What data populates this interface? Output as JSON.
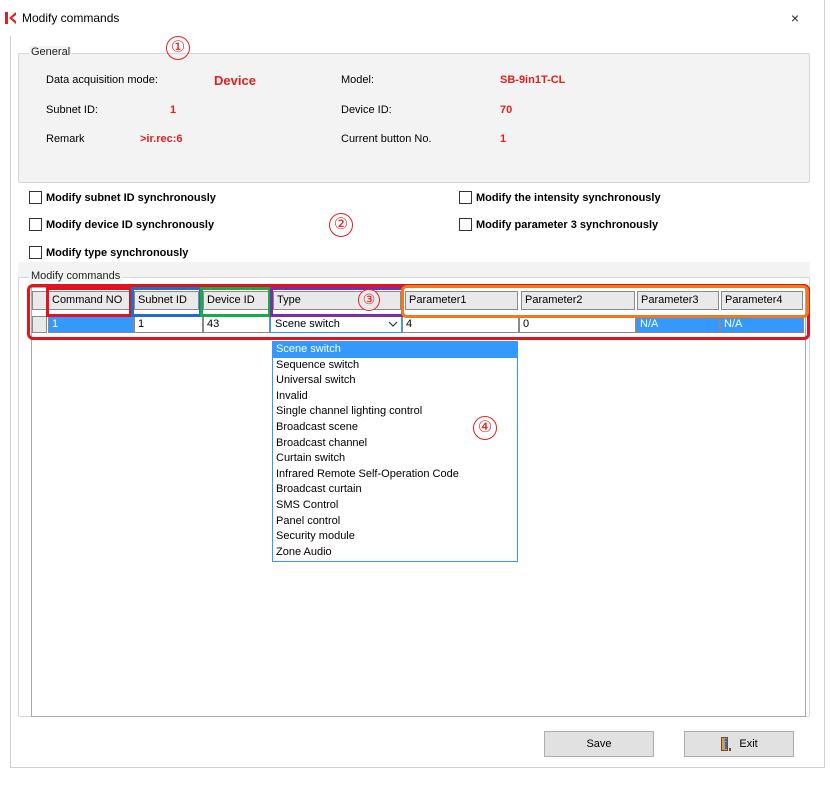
{
  "window": {
    "title": "Modify commands",
    "close": "×"
  },
  "general": {
    "legend": "General",
    "marker": "①",
    "fields": [
      {
        "label": "Data acquisition mode:",
        "value": "Device"
      },
      {
        "label": "Model:",
        "value": "SB-9in1T-CL"
      },
      {
        "label": "Subnet ID:",
        "value": "1"
      },
      {
        "label": "Device ID:",
        "value": "70"
      },
      {
        "label": "Remark",
        "value": ">ir.rec:6"
      },
      {
        "label": "Current button No.",
        "value": "1"
      }
    ]
  },
  "sync_options": {
    "marker": "②",
    "items": [
      {
        "label": "Modify subnet ID synchronously",
        "checked": false
      },
      {
        "label": "Modify the intensity synchronously",
        "checked": false
      },
      {
        "label": "Modify device ID synchronously",
        "checked": false
      },
      {
        "label": "Modify parameter 3 synchronously",
        "checked": false
      },
      {
        "label": "Modify type synchronously",
        "checked": false
      }
    ]
  },
  "modify_commands": {
    "legend": "Modify commands",
    "header_marker": "③",
    "columns": [
      "Command NO",
      "Subnet ID",
      "Device ID",
      "Type",
      "Parameter1",
      "Parameter2",
      "Parameter3",
      "Parameter4"
    ],
    "row": [
      "1",
      "1",
      "43",
      "Scene switch",
      "4",
      "0",
      "N/A",
      "N/A"
    ],
    "type_dropdown": {
      "marker": "④",
      "selected": "Scene switch",
      "options": [
        "Scene switch",
        "Sequence switch",
        "Universal switch",
        "Invalid",
        "Single channel lighting control",
        "Broadcast scene",
        "Broadcast channel",
        "Curtain switch",
        "Infrared Remote Self-Operation Code",
        "Broadcast curtain",
        "SMS Control",
        "Panel control",
        "Security module",
        "Zone Audio"
      ]
    }
  },
  "buttons": {
    "save": "Save",
    "exit": "Exit"
  },
  "colors": {
    "value_red": "#e02020",
    "selection_blue": "#3399ff",
    "outline_red": "#e0141e",
    "outline_blue": "#1f6fc8",
    "outline_green": "#1aa84a",
    "outline_purple": "#7a2fa8",
    "outline_orange": "#f07a1a"
  },
  "icons": {
    "app": "app-logo-icon",
    "close": "close-icon",
    "dropdown": "chevron-down-icon",
    "exit": "exit-door-icon"
  }
}
